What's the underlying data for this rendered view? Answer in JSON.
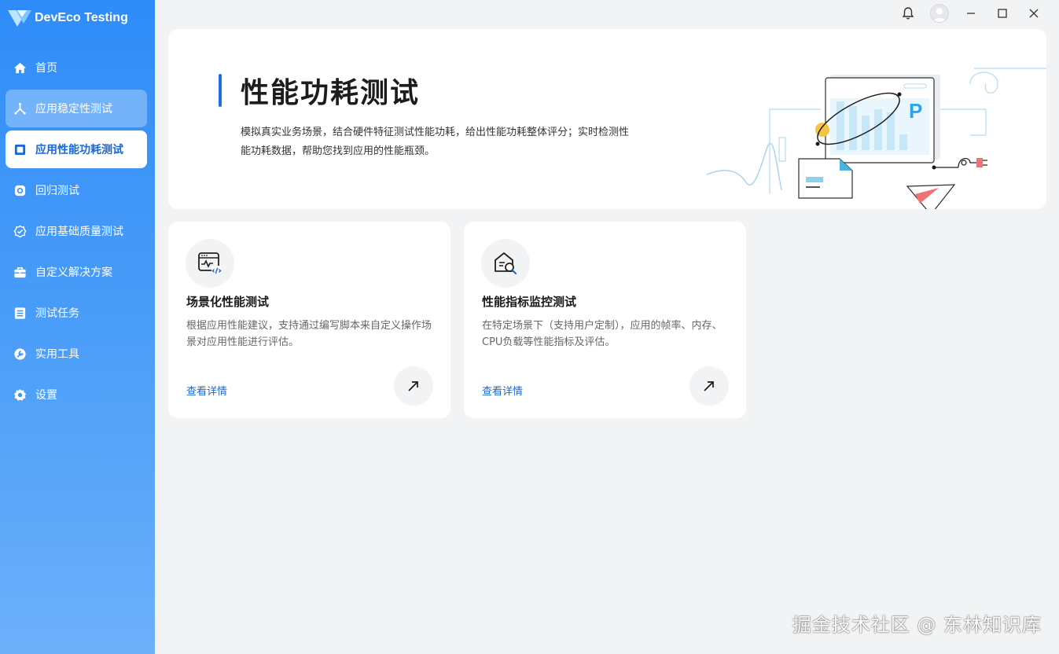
{
  "app": {
    "title": "DevEco Testing"
  },
  "sidebar": {
    "items": [
      {
        "label": "首页",
        "icon": "home-icon"
      },
      {
        "label": "应用稳定性测试",
        "icon": "stability-icon"
      },
      {
        "label": "应用性能功耗测试",
        "icon": "performance-icon"
      },
      {
        "label": "回归测试",
        "icon": "regression-icon"
      },
      {
        "label": "应用基础质量测试",
        "icon": "quality-check-icon"
      },
      {
        "label": "自定义解决方案",
        "icon": "toolbox-icon"
      },
      {
        "label": "测试任务",
        "icon": "task-list-icon"
      },
      {
        "label": "实用工具",
        "icon": "wrench-icon"
      },
      {
        "label": "设置",
        "icon": "gear-icon"
      }
    ],
    "active_index": 2
  },
  "hero": {
    "title": "性能功耗测试",
    "description": "模拟真实业务场景，结合硬件特征测试性能功耗，给出性能功耗整体评分；实时检测性能功耗数据，帮助您找到应用的性能瓶颈。",
    "illustration_letter": "P"
  },
  "cards": [
    {
      "title": "场景化性能测试",
      "description": "根据应用性能建议，支持通过编写脚本来自定义操作场景对应用性能进行评估。",
      "link": "查看详情",
      "icon": "scenario-code-icon"
    },
    {
      "title": "性能指标监控测试",
      "description": "在特定场景下（支持用户定制），应用的帧率、内存、CPU负载等性能指标及评估。",
      "link": "查看详情",
      "icon": "monitor-search-icon"
    }
  ],
  "watermark": "掘金技术社区 @ 东林知识库",
  "colors": {
    "accent": "#1668dc",
    "sidebar_top": "#2f8cf8",
    "sidebar_bottom": "#6db0fa"
  }
}
